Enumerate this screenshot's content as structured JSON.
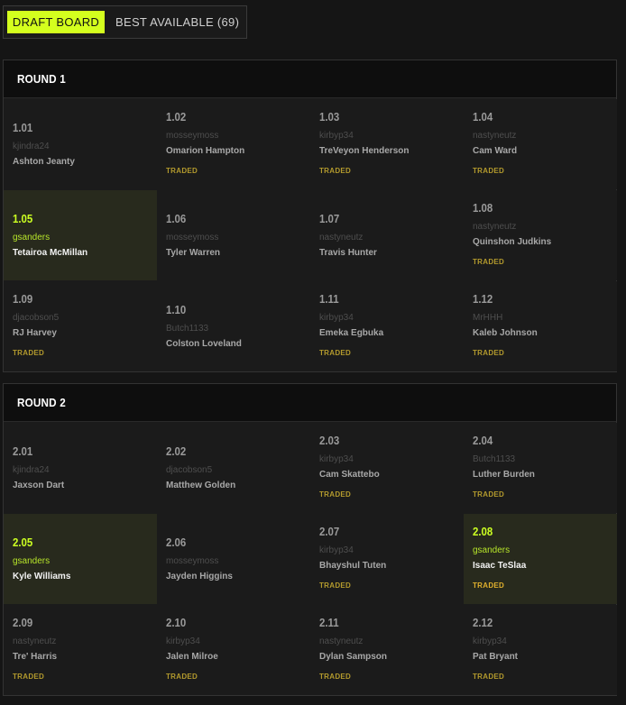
{
  "tabs": {
    "draft_board": "DRAFT BOARD",
    "best_available": "BEST AVAILABLE (69)"
  },
  "rounds": [
    {
      "title": "ROUND 1",
      "picks": [
        {
          "pick": "1.01",
          "owner": "kjindra24",
          "player": "Ashton Jeanty",
          "traded": ""
        },
        {
          "pick": "1.02",
          "owner": "mosseymoss",
          "player": "Omarion Hampton",
          "traded": "TRADED"
        },
        {
          "pick": "1.03",
          "owner": "kirbyp34",
          "player": "TreVeyon Henderson",
          "traded": "TRADED"
        },
        {
          "pick": "1.04",
          "owner": "nastyneutz",
          "player": "Cam Ward",
          "traded": "TRADED"
        },
        {
          "pick": "1.05",
          "owner": "gsanders",
          "player": "Tetairoa McMillan",
          "traded": ""
        },
        {
          "pick": "1.06",
          "owner": "mosseymoss",
          "player": "Tyler Warren",
          "traded": ""
        },
        {
          "pick": "1.07",
          "owner": "nastyneutz",
          "player": "Travis Hunter",
          "traded": ""
        },
        {
          "pick": "1.08",
          "owner": "nastyneutz",
          "player": "Quinshon Judkins",
          "traded": "TRADED"
        },
        {
          "pick": "1.09",
          "owner": "djacobson5",
          "player": "RJ Harvey",
          "traded": "TRADED"
        },
        {
          "pick": "1.10",
          "owner": "Butch1133",
          "player": "Colston Loveland",
          "traded": ""
        },
        {
          "pick": "1.11",
          "owner": "kirbyp34",
          "player": "Emeka Egbuka",
          "traded": "TRADED"
        },
        {
          "pick": "1.12",
          "owner": "MrHHH",
          "player": "Kaleb Johnson",
          "traded": "TRADED"
        }
      ]
    },
    {
      "title": "ROUND 2",
      "picks": [
        {
          "pick": "2.01",
          "owner": "kjindra24",
          "player": "Jaxson Dart",
          "traded": ""
        },
        {
          "pick": "2.02",
          "owner": "djacobson5",
          "player": "Matthew Golden",
          "traded": ""
        },
        {
          "pick": "2.03",
          "owner": "kirbyp34",
          "player": "Cam Skattebo",
          "traded": "TRADED"
        },
        {
          "pick": "2.04",
          "owner": "Butch1133",
          "player": "Luther Burden",
          "traded": "TRADED"
        },
        {
          "pick": "2.05",
          "owner": "gsanders",
          "player": "Kyle Williams",
          "traded": ""
        },
        {
          "pick": "2.06",
          "owner": "mosseymoss",
          "player": "Jayden Higgins",
          "traded": ""
        },
        {
          "pick": "2.07",
          "owner": "kirbyp34",
          "player": "Bhayshul Tuten",
          "traded": "TRADED"
        },
        {
          "pick": "2.08",
          "owner": "gsanders",
          "player": "Isaac TeSlaa",
          "traded": "TRADED"
        },
        {
          "pick": "2.09",
          "owner": "nastyneutz",
          "player": "Tre' Harris",
          "traded": "TRADED"
        },
        {
          "pick": "2.10",
          "owner": "kirbyp34",
          "player": "Jalen Milroe",
          "traded": "TRADED"
        },
        {
          "pick": "2.11",
          "owner": "nastyneutz",
          "player": "Dylan Sampson",
          "traded": "TRADED"
        },
        {
          "pick": "2.12",
          "owner": "kirbyp34",
          "player": "Pat Bryant",
          "traded": "TRADED"
        }
      ]
    }
  ],
  "colors": {
    "accent": "#d4ff1e",
    "highlight_bg": "#282a1d",
    "traded": "#b39a2d"
  }
}
